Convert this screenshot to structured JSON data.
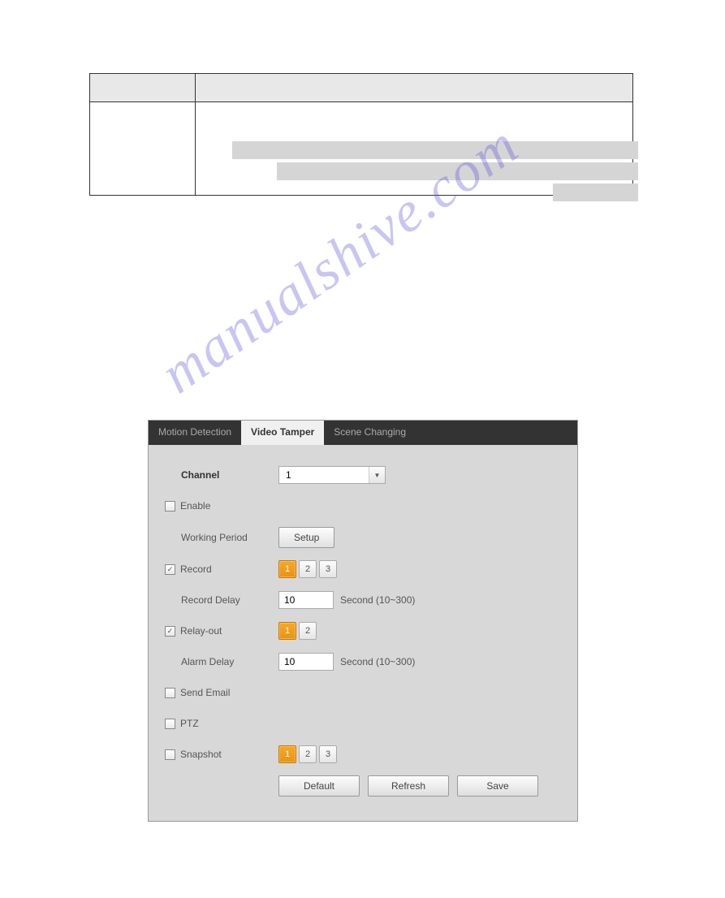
{
  "watermark": "manualshive.com",
  "tabs": {
    "motion": "Motion Detection",
    "tamper": "Video Tamper",
    "scene": "Scene Changing"
  },
  "form": {
    "channel_label": "Channel",
    "channel_value": "1",
    "enable_label": "Enable",
    "working_period_label": "Working Period",
    "setup_btn": "Setup",
    "record_label": "Record",
    "record_delay_label": "Record Delay",
    "record_delay_value": "10",
    "record_delay_hint": "Second (10~300)",
    "relay_label": "Relay-out",
    "alarm_delay_label": "Alarm Delay",
    "alarm_delay_value": "10",
    "alarm_delay_hint": "Second (10~300)",
    "send_email_label": "Send Email",
    "ptz_label": "PTZ",
    "snapshot_label": "Snapshot",
    "nums": {
      "n1": "1",
      "n2": "2",
      "n3": "3"
    }
  },
  "actions": {
    "default": "Default",
    "refresh": "Refresh",
    "save": "Save"
  }
}
